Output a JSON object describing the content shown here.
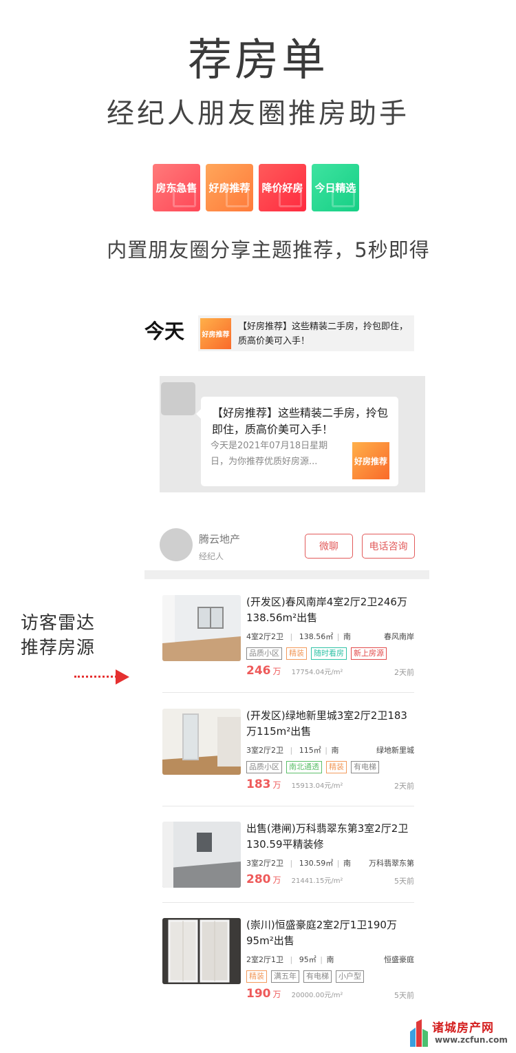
{
  "header": {
    "title": "荐房单",
    "subtitle": "经纪人朋友圈推房助手",
    "badges": [
      {
        "label": "房东急售",
        "color": "#ff5f6d"
      },
      {
        "label": "好房推荐",
        "color": "#ff8a45"
      },
      {
        "label": "降价好房",
        "color": "#ff3f4f"
      },
      {
        "label": "今日精选",
        "color": "#1ed68e"
      }
    ],
    "tagline": "内置朋友圈分享主题推荐，5秒即得"
  },
  "moments": {
    "today_label": "今天",
    "thumb_label": "好房推荐",
    "post_text": "【好房推荐】这些精装二手房，拎包即住，质高价美可入手！"
  },
  "chat": {
    "title": "【好房推荐】这些精装二手房，拎包即住，质高价美可入手！",
    "desc": "今天是2021年07月18日星期日，为你推荐优质好房源...",
    "thumb_label": "好房推荐"
  },
  "agent": {
    "name": "腾云地产",
    "role": "经纪人",
    "wechat_button": "微聊",
    "phone_button": "电话咨询"
  },
  "side_note": {
    "line1": "访客雷达",
    "line2": "推荐房源"
  },
  "listings": [
    {
      "title": "(开发区)春风南岸4室2厅2卫246万138.56m²出售",
      "layout": "4室2厅2卫",
      "size": "138.56㎡",
      "orientation": "南",
      "community": "春风南岸",
      "tags": [
        {
          "text": "品质小区",
          "color": "#888888"
        },
        {
          "text": "精装",
          "color": "#f29a5c"
        },
        {
          "text": "随时看房",
          "color": "#2fc2a6"
        },
        {
          "text": "新上房源",
          "color": "#e24a4a"
        }
      ],
      "price": "246",
      "price_unit": "万",
      "unit_price": "17754.04元/m²",
      "posted": "2天前"
    },
    {
      "title": "(开发区)绿地新里城3室2厅2卫183万115m²出售",
      "layout": "3室2厅2卫",
      "size": "115㎡",
      "orientation": "南",
      "community": "绿地新里城",
      "tags": [
        {
          "text": "品质小区",
          "color": "#888888"
        },
        {
          "text": "南北通透",
          "color": "#5cbf6a"
        },
        {
          "text": "精装",
          "color": "#f29a5c"
        },
        {
          "text": "有电梯",
          "color": "#888888"
        }
      ],
      "price": "183",
      "price_unit": "万",
      "unit_price": "15913.04元/m²",
      "posted": "2天前"
    },
    {
      "title": "出售(港闸)万科翡翠东第3室2厅2卫130.59平精装修",
      "layout": "3室2厅2卫",
      "size": "130.59㎡",
      "orientation": "南",
      "community": "万科翡翠东第",
      "tags": [],
      "price": "280",
      "price_unit": "万",
      "unit_price": "21441.15元/m²",
      "posted": "5天前"
    },
    {
      "title": "(崇川)恒盛豪庭2室2厅1卫190万95m²出售",
      "layout": "2室2厅1卫",
      "size": "95㎡",
      "orientation": "南",
      "community": "恒盛豪庭",
      "tags": [
        {
          "text": "精装",
          "color": "#f29a5c"
        },
        {
          "text": "满五年",
          "color": "#888888"
        },
        {
          "text": "有电梯",
          "color": "#888888"
        },
        {
          "text": "小户型",
          "color": "#888888"
        }
      ],
      "price": "190",
      "price_unit": "万",
      "unit_price": "20000.00元/m²",
      "posted": "5天前"
    }
  ],
  "watermark": {
    "name": "诸城房产网",
    "url": "www.zcfun.com"
  }
}
